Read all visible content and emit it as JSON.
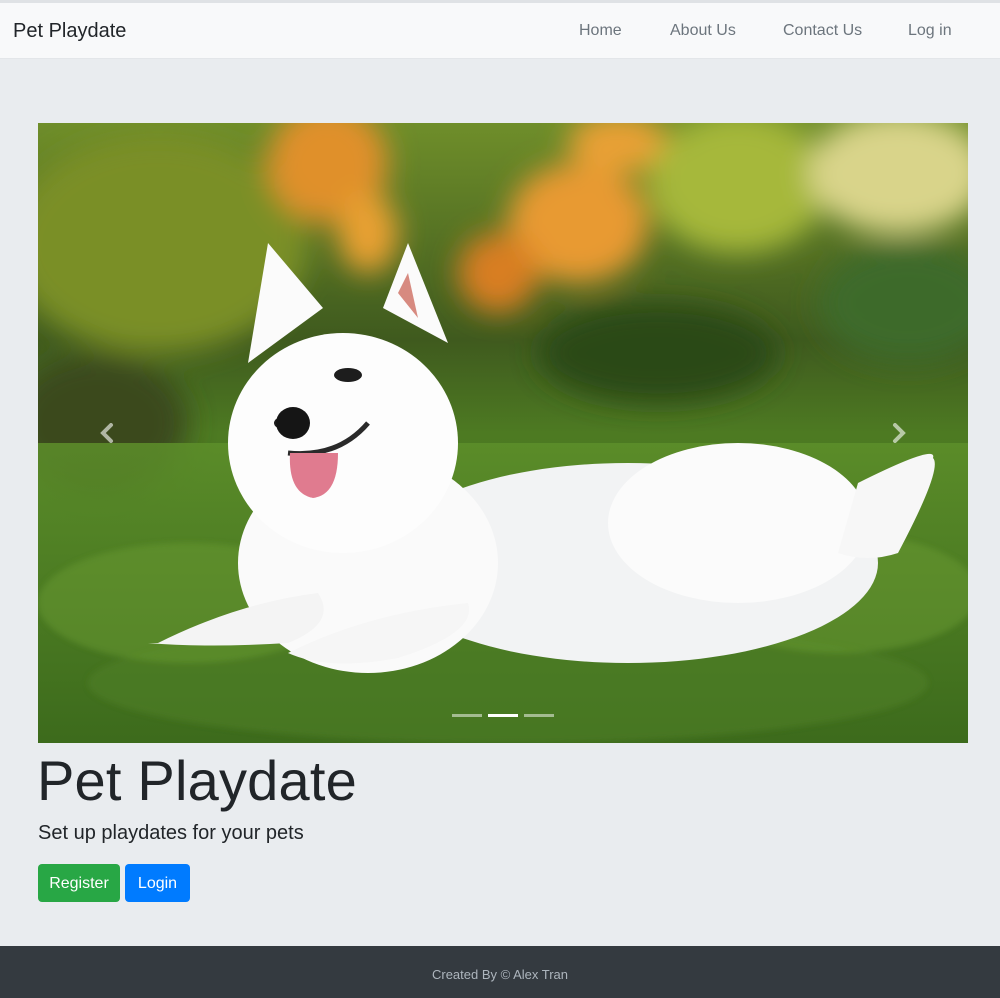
{
  "navbar": {
    "brand": "Pet Playdate",
    "links": [
      {
        "label": "Home"
      },
      {
        "label": "About Us"
      },
      {
        "label": "Contact Us"
      },
      {
        "label": "Log in"
      }
    ]
  },
  "carousel": {
    "slide_count": 3,
    "active_index": 1,
    "prev_icon": "chevron-left-icon",
    "next_icon": "chevron-right-icon"
  },
  "hero": {
    "title": "Pet Playdate",
    "subtitle": "Set up playdates for your pets",
    "register_label": "Register",
    "login_label": "Login"
  },
  "footer": {
    "text": "Created By © Alex Tran"
  },
  "colors": {
    "background": "#e9ecef",
    "navbar": "#f8f9fa",
    "register_button": "#28a745",
    "login_button": "#007bff",
    "footer": "#343a40"
  }
}
